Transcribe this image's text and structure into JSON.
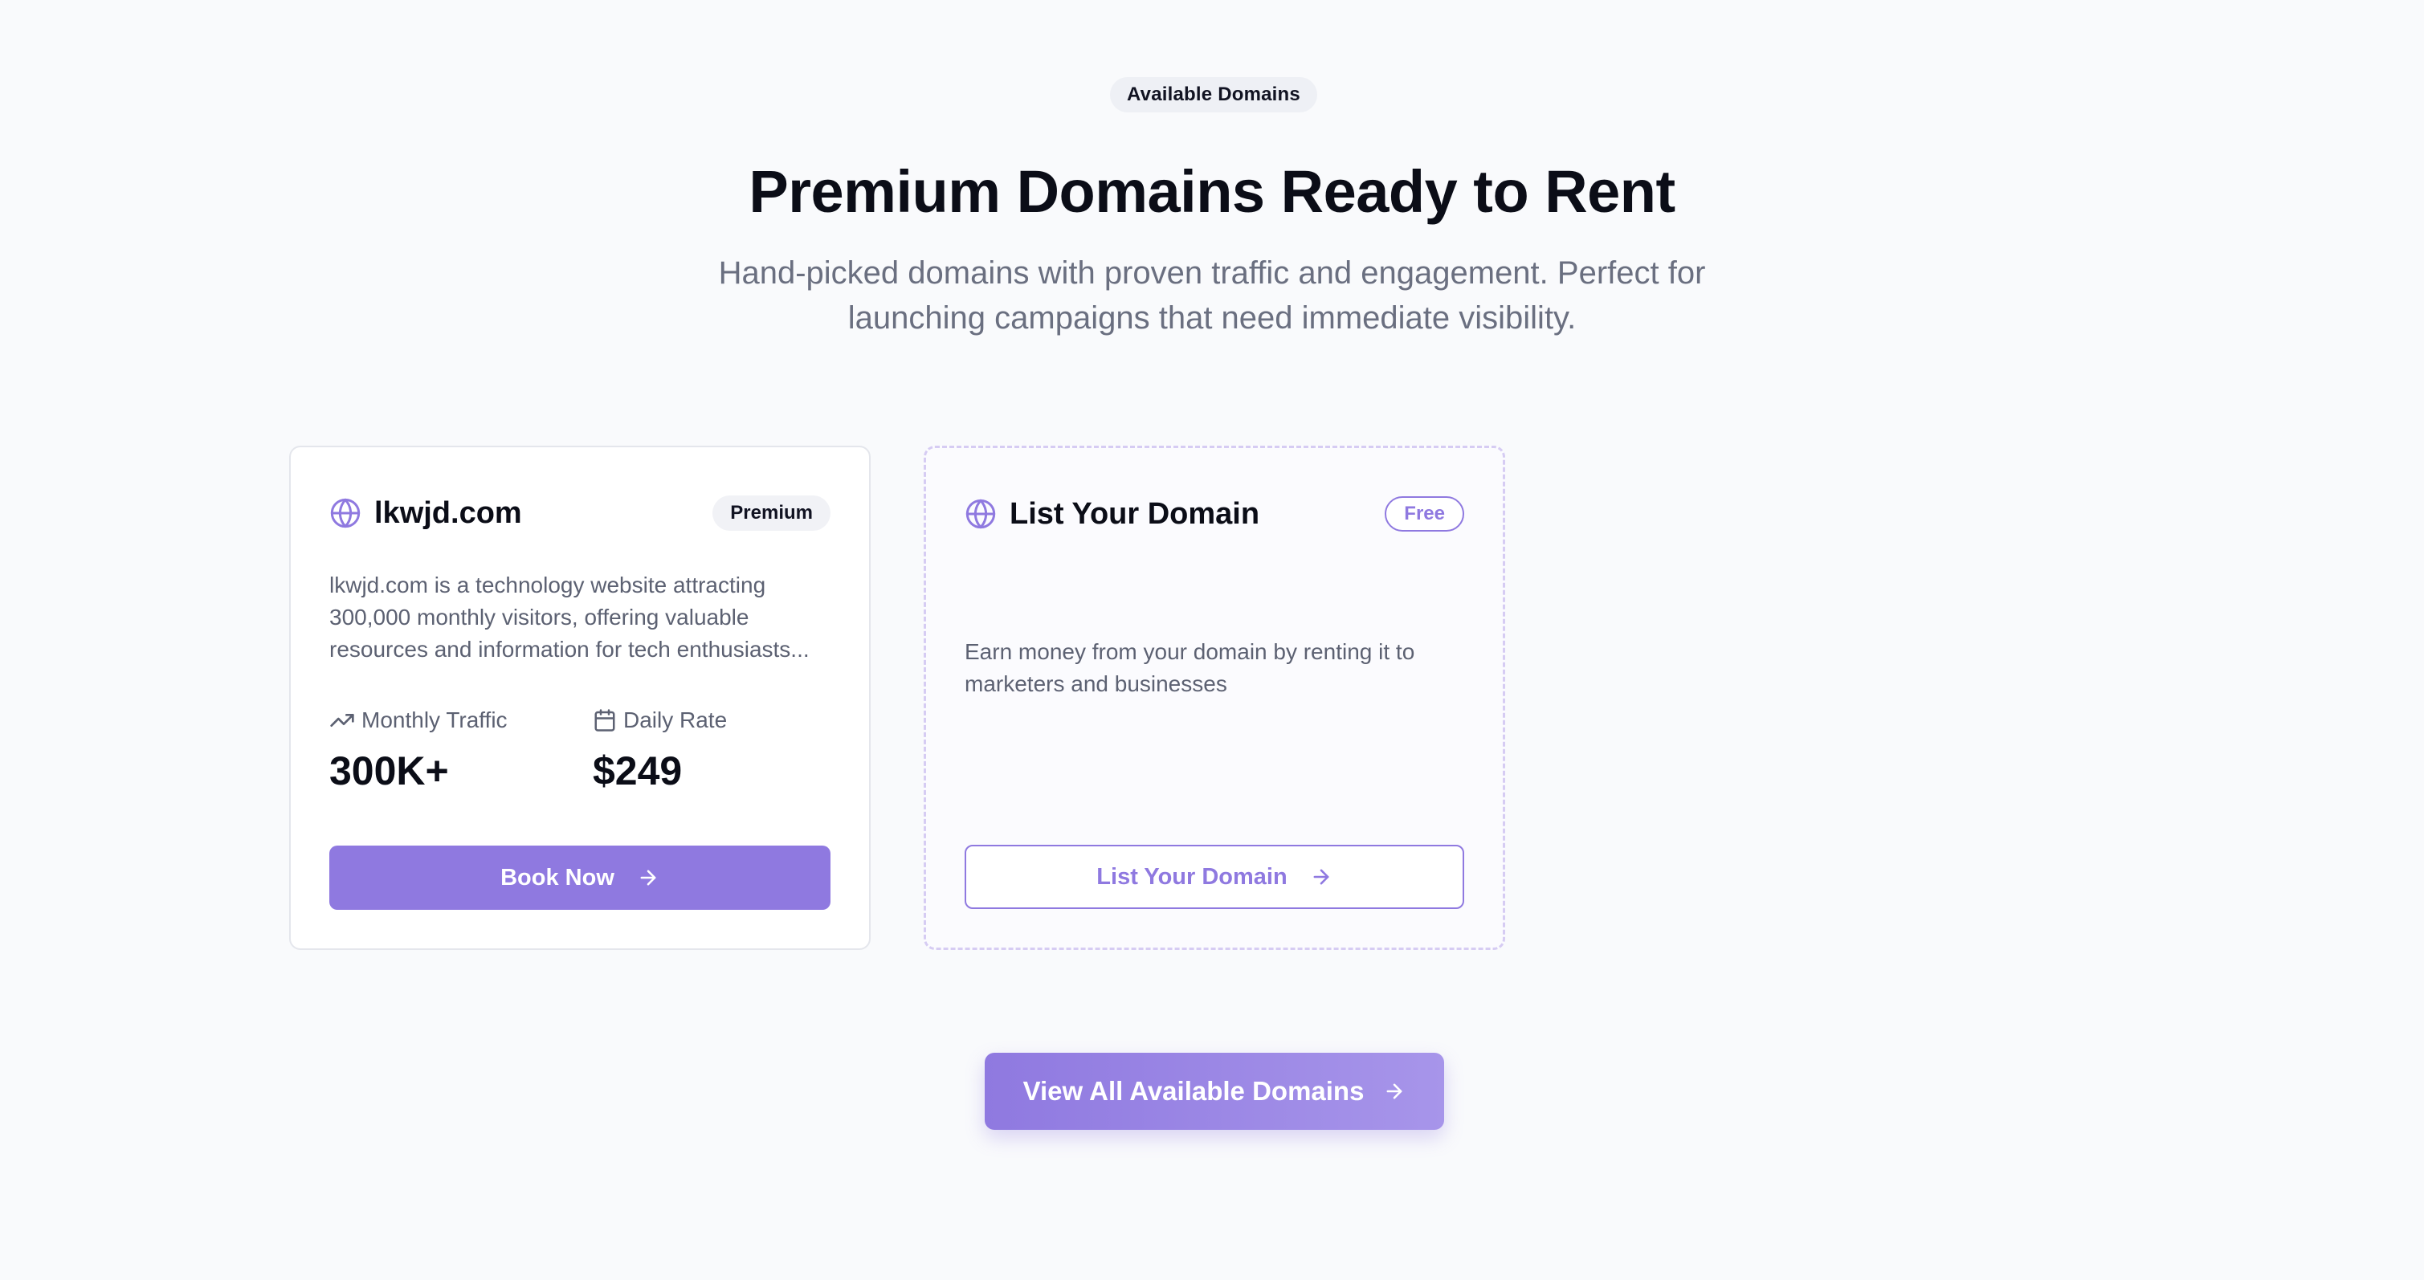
{
  "section": {
    "eyebrow": "Available Domains",
    "title": "Premium Domains Ready to Rent",
    "subtitle": "Hand-picked domains with proven traffic and engagement. Perfect for launching campaigns that need immediate visibility."
  },
  "domain_card": {
    "icon": "globe-icon",
    "name": "lkwjd.com",
    "badge": "Premium",
    "description": "lkwjd.com is a technology website attracting 300,000 monthly visitors, offering valuable resources and information for tech enthusiasts...",
    "traffic_label": "Monthly Traffic",
    "traffic_value": "300K+",
    "rate_label": "Daily Rate",
    "rate_value": "$249",
    "button_label": "Book Now"
  },
  "list_card": {
    "icon": "globe-icon",
    "name": "List Your Domain",
    "badge": "Free",
    "description": "Earn money from your domain by renting it to marketers and businesses",
    "button_label": "List Your Domain"
  },
  "cta": {
    "label": "View All Available Domains"
  },
  "colors": {
    "accent": "#8f79e0",
    "background": "#f9fafc",
    "text": "#0b0d17",
    "muted": "#6a6f80"
  }
}
